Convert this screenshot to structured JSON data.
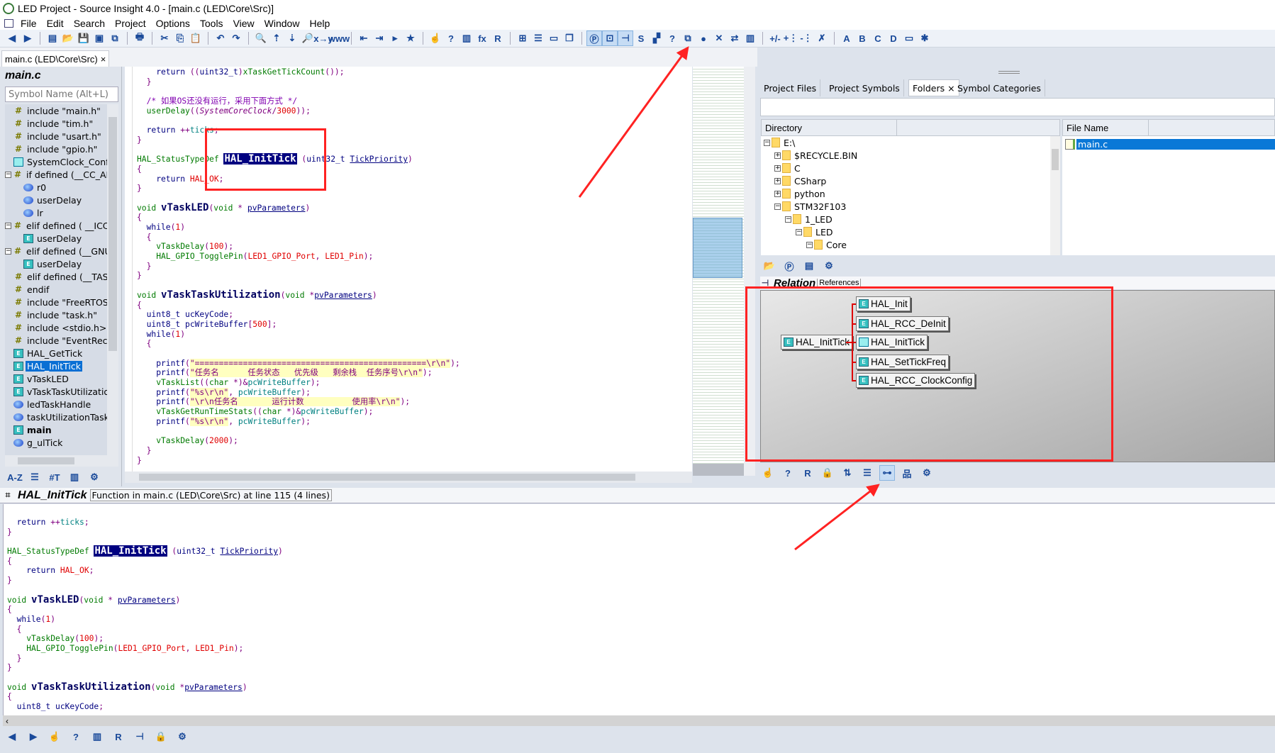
{
  "window": {
    "title": "LED Project - Source Insight 4.0 - [main.c (LED\\Core\\Src)]"
  },
  "menu": [
    "File",
    "Edit",
    "Search",
    "Project",
    "Options",
    "Tools",
    "View",
    "Window",
    "Help"
  ],
  "toolbar": {
    "groups": [
      [
        "◀",
        "▶"
      ],
      [
        "▤",
        "📂",
        "💾",
        "▣",
        "⧉"
      ],
      [
        "🖶"
      ],
      [
        "✂",
        "⎘",
        "📋"
      ],
      [
        "↶",
        "↷"
      ],
      [
        "🔍",
        "⇡",
        "⇣",
        "🔎",
        "x→y",
        "www"
      ],
      [
        "⇤",
        "⇥",
        "▸",
        "★"
      ],
      [
        "☝",
        "?",
        "▥",
        "fx",
        "R"
      ],
      [
        "⊞",
        "☰",
        "▭",
        "❐"
      ],
      [
        "Ⓟ",
        "⊡",
        "⊣",
        "S",
        "▞",
        "?",
        "⧉",
        "●",
        "✕",
        "⇄",
        "▥"
      ],
      [
        "+/-",
        "+⋮",
        "-⋮",
        "✗"
      ],
      [
        "A",
        "B",
        "C",
        "D",
        "▭",
        "✱"
      ]
    ],
    "active": [
      "Ⓟ",
      "⊡",
      "⊣"
    ]
  },
  "doc_tab": {
    "label": "main.c (LED\\Core\\Src)",
    "close": "×"
  },
  "symbol_panel": {
    "title": "main.c",
    "search_placeholder": "Symbol Name (Alt+L)",
    "items": [
      {
        "icon": "hash",
        "label": "include \"main.h\"",
        "depth": 0
      },
      {
        "icon": "hash",
        "label": "include \"tim.h\"",
        "depth": 0
      },
      {
        "icon": "hash",
        "label": "include \"usart.h\"",
        "depth": 0
      },
      {
        "icon": "hash",
        "label": "include \"gpio.h\"",
        "depth": 0
      },
      {
        "icon": "macro",
        "label": "SystemClock_Config",
        "depth": 0
      },
      {
        "icon": "hash",
        "label": "if defined (__CC_AR",
        "depth": 0,
        "expander": "−"
      },
      {
        "icon": "var",
        "label": "r0",
        "depth": 1
      },
      {
        "icon": "var",
        "label": "userDelay",
        "depth": 1
      },
      {
        "icon": "var",
        "label": "lr",
        "depth": 1
      },
      {
        "icon": "hash",
        "label": "elif defined ( __ICCA",
        "depth": 0,
        "expander": "−"
      },
      {
        "icon": "func",
        "label": "userDelay",
        "depth": 1
      },
      {
        "icon": "hash",
        "label": "elif defined (__GNU",
        "depth": 0,
        "expander": "−"
      },
      {
        "icon": "func",
        "label": "userDelay",
        "depth": 1
      },
      {
        "icon": "hash",
        "label": "elif defined (__TASK",
        "depth": 0
      },
      {
        "icon": "hash",
        "label": "endif",
        "depth": 0
      },
      {
        "icon": "hash",
        "label": "include \"FreeRTOS.",
        "depth": 0
      },
      {
        "icon": "hash",
        "label": "include \"task.h\"",
        "depth": 0
      },
      {
        "icon": "hash",
        "label": "include <stdio.h>",
        "depth": 0
      },
      {
        "icon": "hash",
        "label": "include \"EventReco",
        "depth": 0
      },
      {
        "icon": "func",
        "label": "HAL_GetTick",
        "depth": 0
      },
      {
        "icon": "func",
        "label": "HAL_InitTick",
        "depth": 0,
        "selected": true
      },
      {
        "icon": "func",
        "label": "vTaskLED",
        "depth": 0
      },
      {
        "icon": "func",
        "label": "vTaskTaskUtilizatio",
        "depth": 0
      },
      {
        "icon": "var",
        "label": "ledTaskHandle",
        "depth": 0
      },
      {
        "icon": "var",
        "label": "taskUtilizationTaskH",
        "depth": 0
      },
      {
        "icon": "func",
        "label": "main",
        "depth": 0,
        "bold": true
      },
      {
        "icon": "var",
        "label": "g_ulTick",
        "depth": 0
      }
    ],
    "tools": [
      "A-Z",
      "☰",
      "#T",
      "▥",
      "⚙"
    ]
  },
  "editor": {
    "lines": [
      [
        [
          "k",
          "    return "
        ],
        [
          "o",
          "(("
        ],
        [
          "k",
          "uint32_t"
        ],
        [
          "o",
          ")"
        ],
        [
          "f",
          "xTaskGetTickCount"
        ],
        [
          "o",
          "());"
        ]
      ],
      [
        [
          "o",
          "  }"
        ]
      ],
      [],
      [
        [
          "m",
          "  /* 如果OS还没有运行，采用下面方式 */"
        ]
      ],
      [
        [
          "f",
          "  userDelay"
        ],
        [
          "o",
          "(("
        ],
        [
          "i",
          "SystemCoreClock"
        ],
        [
          "o",
          "/"
        ],
        [
          "n",
          "3000"
        ],
        [
          "o",
          "));"
        ]
      ],
      [],
      [
        [
          "k",
          "  return "
        ],
        [
          "o",
          "++"
        ],
        [
          "v",
          "ticks"
        ],
        [
          "o",
          ";"
        ]
      ],
      [
        [
          "o",
          "}"
        ]
      ],
      [],
      [
        [
          "t",
          "HAL_StatusTypeDef "
        ],
        [
          "h",
          "HAL_InitTick"
        ],
        [
          "o",
          " ("
        ],
        [
          "k",
          "uint32_t "
        ],
        [
          "p",
          "TickPriority"
        ],
        [
          "o",
          ")"
        ]
      ],
      [
        [
          "o",
          "{"
        ]
      ],
      [
        [
          "k",
          "    return "
        ],
        [
          "c",
          "HAL_OK"
        ],
        [
          "o",
          ";"
        ]
      ],
      [
        [
          "o",
          "}"
        ]
      ],
      [],
      [
        [
          "t",
          "void "
        ],
        [
          "b",
          "vTaskLED"
        ],
        [
          "o",
          "("
        ],
        [
          "t",
          "void"
        ],
        [
          "o",
          " * "
        ],
        [
          "p",
          "pvParameters"
        ],
        [
          "o",
          ")"
        ]
      ],
      [
        [
          "o",
          "{"
        ]
      ],
      [
        [
          "k",
          "  while"
        ],
        [
          "o",
          "("
        ],
        [
          "n",
          "1"
        ],
        [
          "o",
          ")"
        ]
      ],
      [
        [
          "o",
          "  {"
        ]
      ],
      [
        [
          "f",
          "    vTaskDelay"
        ],
        [
          "o",
          "("
        ],
        [
          "n",
          "100"
        ],
        [
          "o",
          ");"
        ]
      ],
      [
        [
          "f",
          "    HAL_GPIO_TogglePin"
        ],
        [
          "o",
          "("
        ],
        [
          "c",
          "LED1_GPIO_Port"
        ],
        [
          "o",
          ", "
        ],
        [
          "c",
          "LED1_Pin"
        ],
        [
          "o",
          ");"
        ]
      ],
      [
        [
          "o",
          "  }"
        ]
      ],
      [
        [
          "o",
          "}"
        ]
      ],
      [],
      [
        [
          "t",
          "void "
        ],
        [
          "b",
          "vTaskTaskUtilization"
        ],
        [
          "o",
          "("
        ],
        [
          "t",
          "void "
        ],
        [
          "o",
          "*"
        ],
        [
          "p",
          "pvParameters"
        ],
        [
          "o",
          ")"
        ]
      ],
      [
        [
          "o",
          "{"
        ]
      ],
      [
        [
          "k",
          "  uint8_t ucKeyCode"
        ],
        [
          "o",
          ";"
        ]
      ],
      [
        [
          "k",
          "  uint8_t pcWriteBuffer"
        ],
        [
          "o",
          "["
        ],
        [
          "n",
          "500"
        ],
        [
          "o",
          "];"
        ]
      ],
      [
        [
          "k",
          "  while"
        ],
        [
          "o",
          "("
        ],
        [
          "n",
          "1"
        ],
        [
          "o",
          ")"
        ]
      ],
      [
        [
          "o",
          "  {"
        ]
      ],
      [],
      [
        [
          "k",
          "    printf"
        ],
        [
          "o",
          "("
        ],
        [
          "s",
          "\"================================================\\r\\n\""
        ],
        [
          "o",
          ");"
        ]
      ],
      [
        [
          "k",
          "    printf"
        ],
        [
          "o",
          "("
        ],
        [
          "s",
          "\"任务名      任务状态   优先级   剩余栈  任务序号\\r\\n\""
        ],
        [
          "o",
          ");"
        ]
      ],
      [
        [
          "f",
          "    vTaskList"
        ],
        [
          "o",
          "(("
        ],
        [
          "t",
          "char "
        ],
        [
          "o",
          "*)&"
        ],
        [
          "v",
          "pcWriteBuffer"
        ],
        [
          "o",
          ");"
        ]
      ],
      [
        [
          "k",
          "    printf"
        ],
        [
          "o",
          "("
        ],
        [
          "s",
          "\"%s\\r\\n\""
        ],
        [
          "o",
          ", "
        ],
        [
          "v",
          "pcWriteBuffer"
        ],
        [
          "o",
          ");"
        ]
      ],
      [
        [
          "k",
          "    printf"
        ],
        [
          "o",
          "("
        ],
        [
          "s",
          "\"\\r\\n任务名       运行计数          使用率\\r\\n\""
        ],
        [
          "o",
          ");"
        ]
      ],
      [
        [
          "f",
          "    vTaskGetRunTimeStats"
        ],
        [
          "o",
          "(("
        ],
        [
          "t",
          "char "
        ],
        [
          "o",
          "*)&"
        ],
        [
          "v",
          "pcWriteBuffer"
        ],
        [
          "o",
          ");"
        ]
      ],
      [
        [
          "k",
          "    printf"
        ],
        [
          "o",
          "("
        ],
        [
          "s",
          "\"%s\\r\\n\""
        ],
        [
          "o",
          ", "
        ],
        [
          "v",
          "pcWriteBuffer"
        ],
        [
          "o",
          ");"
        ]
      ],
      [],
      [
        [
          "f",
          "    vTaskDelay"
        ],
        [
          "o",
          "("
        ],
        [
          "n",
          "2000"
        ],
        [
          "o",
          ");"
        ]
      ],
      [
        [
          "o",
          "  }"
        ]
      ],
      [
        [
          "o",
          "}"
        ]
      ]
    ]
  },
  "right_panel": {
    "tabs": [
      {
        "label": "Project Files"
      },
      {
        "label": "Project Symbols"
      },
      {
        "label": "Folders",
        "close": "×",
        "active": true
      },
      {
        "label": "Symbol Categories"
      }
    ],
    "directory_header": "Directory",
    "file_header": "File Name",
    "directories": [
      {
        "label": "E:\\",
        "depth": 0,
        "expander": "−"
      },
      {
        "label": "$RECYCLE.BIN",
        "depth": 1,
        "expander": "+"
      },
      {
        "label": "C",
        "depth": 1,
        "expander": "+"
      },
      {
        "label": "CSharp",
        "depth": 1,
        "expander": "+"
      },
      {
        "label": "python",
        "depth": 1,
        "expander": "+"
      },
      {
        "label": "STM32F103",
        "depth": 1,
        "expander": "−"
      },
      {
        "label": "1_LED",
        "depth": 2,
        "expander": "−"
      },
      {
        "label": "LED",
        "depth": 3,
        "expander": "−"
      },
      {
        "label": "Core",
        "depth": 4,
        "expander": "−"
      }
    ],
    "files": [
      {
        "label": "main.c",
        "selected": true
      }
    ],
    "tools": [
      "📂",
      "Ⓟ",
      "▤",
      "⚙"
    ]
  },
  "relation": {
    "title": "Relation",
    "subtitle": "References",
    "root": "HAL_InitTick",
    "children": [
      "HAL_Init",
      "HAL_RCC_DeInit",
      "HAL_InitTick",
      "HAL_SetTickFreq",
      "HAL_RCC_ClockConfig"
    ],
    "line_color": "#dd0000",
    "tools": [
      "☝",
      "?",
      "R",
      "🔒",
      "⇅",
      "☰",
      "⊶",
      "品",
      "⚙"
    ]
  },
  "context": {
    "symbol": "HAL_InitTick",
    "info": "Function in main.c (LED\\Core\\Src) at line 115 (4 lines)",
    "lines": [
      [
        [
          "k",
          "  return "
        ],
        [
          "o",
          "++"
        ],
        [
          "v",
          "ticks"
        ],
        [
          "o",
          ";"
        ]
      ],
      [
        [
          "o",
          "}"
        ]
      ],
      [],
      [
        [
          "t",
          "HAL_StatusTypeDef "
        ],
        [
          "h",
          "HAL_InitTick"
        ],
        [
          "o",
          " ("
        ],
        [
          "k",
          "uint32_t "
        ],
        [
          "p",
          "TickPriority"
        ],
        [
          "o",
          ")"
        ]
      ],
      [
        [
          "o",
          "{"
        ]
      ],
      [
        [
          "k",
          "    return "
        ],
        [
          "c",
          "HAL_OK"
        ],
        [
          "o",
          ";"
        ]
      ],
      [
        [
          "o",
          "}"
        ]
      ],
      [],
      [
        [
          "t",
          "void "
        ],
        [
          "b",
          "vTaskLED"
        ],
        [
          "o",
          "("
        ],
        [
          "t",
          "void"
        ],
        [
          "o",
          " * "
        ],
        [
          "p",
          "pvParameters"
        ],
        [
          "o",
          ")"
        ]
      ],
      [
        [
          "o",
          "{"
        ]
      ],
      [
        [
          "k",
          "  while"
        ],
        [
          "o",
          "("
        ],
        [
          "n",
          "1"
        ],
        [
          "o",
          ")"
        ]
      ],
      [
        [
          "o",
          "  {"
        ]
      ],
      [
        [
          "f",
          "    vTaskDelay"
        ],
        [
          "o",
          "("
        ],
        [
          "n",
          "100"
        ],
        [
          "o",
          ");"
        ]
      ],
      [
        [
          "f",
          "    HAL_GPIO_TogglePin"
        ],
        [
          "o",
          "("
        ],
        [
          "c",
          "LED1_GPIO_Port"
        ],
        [
          "o",
          ", "
        ],
        [
          "c",
          "LED1_Pin"
        ],
        [
          "o",
          ");"
        ]
      ],
      [
        [
          "o",
          "  }"
        ]
      ],
      [
        [
          "o",
          "}"
        ]
      ],
      [],
      [
        [
          "t",
          "void "
        ],
        [
          "b",
          "vTaskTaskUtilization"
        ],
        [
          "o",
          "("
        ],
        [
          "t",
          "void "
        ],
        [
          "o",
          "*"
        ],
        [
          "p",
          "pvParameters"
        ],
        [
          "o",
          ")"
        ]
      ],
      [
        [
          "o",
          "{"
        ]
      ],
      [
        [
          "k",
          "  uint8_t ucKeyCode"
        ],
        [
          "o",
          ";"
        ]
      ]
    ],
    "tools": [
      "◀",
      "▶",
      "☝",
      "?",
      "▥",
      "R",
      "⊣",
      "🔒",
      "⚙"
    ]
  },
  "annotation_color": "#ff2222"
}
